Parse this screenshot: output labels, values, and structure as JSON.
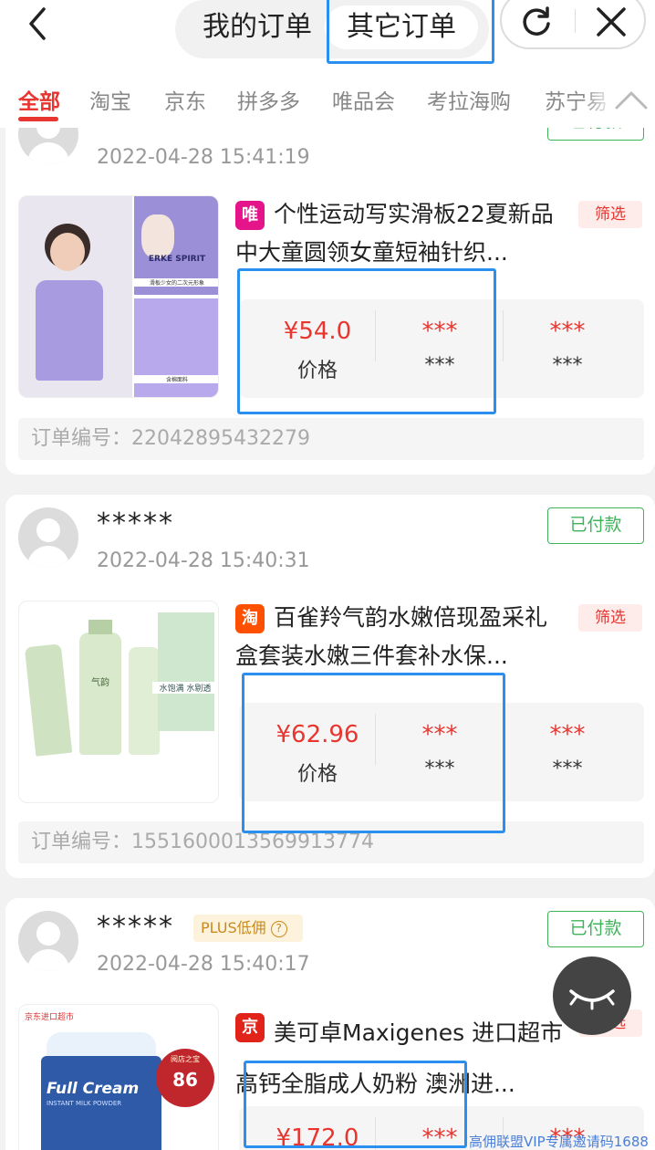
{
  "header": {
    "tabs": [
      "我的订单",
      "其它订单"
    ],
    "active_tab": "其它订单"
  },
  "platform_tabs": [
    "全部",
    "淘宝",
    "京东",
    "拼多多",
    "唯品会",
    "考拉海购",
    "苏宁易"
  ],
  "orders": [
    {
      "time": "2022-04-28 15:41:19",
      "status": "已付款",
      "platform_badge": "唯",
      "title": "个性运动写实滑板22夏新品中大童圆领女童短袖针织...",
      "filter_label": "筛选",
      "price_value": "¥54.0",
      "price_label": "价格",
      "col2_value": "***",
      "col2_label": "***",
      "col3_value": "***",
      "col3_label": "***",
      "order_no": "订单编号：22042895432279",
      "thumb_text_1": "ERKE SPIRIT",
      "thumb_text_2": "滑板少女的二次元形象",
      "thumb_text_3": "含棉面料"
    },
    {
      "nick": "*****",
      "time": "2022-04-28 15:40:31",
      "status": "已付款",
      "platform_badge": "淘",
      "title": "百雀羚气韵水嫩倍现盈采礼盒套装水嫩三件套补水保...",
      "filter_label": "筛选",
      "price_value": "¥62.96",
      "price_label": "价格",
      "col2_value": "***",
      "col2_label": "***",
      "col3_value": "***",
      "col3_label": "***",
      "order_no": "订单编号：1551600013569913774",
      "thumb_text_1": "气韵",
      "thumb_text_2": "水饱满 水剔透"
    },
    {
      "nick": "*****",
      "plus_label": "PLUS低佣",
      "time": "2022-04-28 15:40:17",
      "status": "已付款",
      "platform_badge": "京",
      "title": "美可卓Maxigenes 进口超市高钙全脂成人奶粉 澳洲进...",
      "filter_label": "筛选",
      "price_value": "¥172.0",
      "col2_value": "***",
      "col3_value": "***",
      "thumb_text_1": "京东进口超市",
      "thumb_text_2": "Full Cream",
      "thumb_text_3": "INSTANT MILK POWDER",
      "thumb_text_4": "86",
      "thumb_text_5": "阅店之宝"
    }
  ],
  "watermark": "高佣联盟VIP专属邀请码1688",
  "colors": {
    "accent_red": "#e8352f",
    "status_green": "#3fb35a",
    "highlight_blue": "#2b8ff0"
  }
}
